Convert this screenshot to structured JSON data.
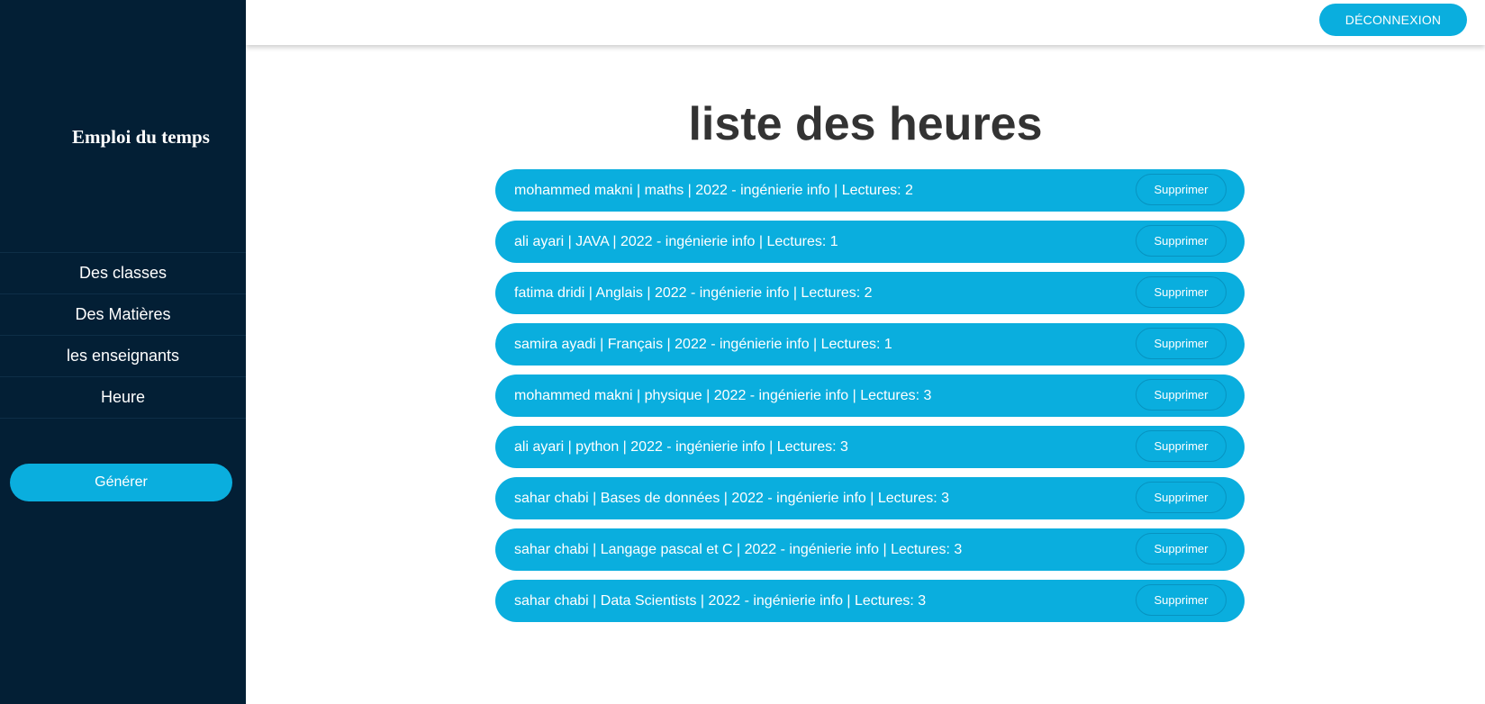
{
  "sidebar": {
    "brand": "Emploi du temps",
    "nav": [
      {
        "label": "Des classes"
      },
      {
        "label": "Des Matières"
      },
      {
        "label": "les enseignants"
      },
      {
        "label": "Heure"
      }
    ],
    "generate_label": "Générer"
  },
  "header": {
    "logout_label": "DÉCONNEXION"
  },
  "main": {
    "title": "liste des heures",
    "delete_label": "Supprimer",
    "items": [
      {
        "text": "mohammed makni | maths | 2022 - ingénierie info | Lectures: 2"
      },
      {
        "text": "ali ayari | JAVA | 2022 - ingénierie info | Lectures: 1"
      },
      {
        "text": "fatima dridi | Anglais | 2022 - ingénierie info | Lectures: 2"
      },
      {
        "text": "samira ayadi | Français | 2022 - ingénierie info | Lectures: 1"
      },
      {
        "text": "mohammed makni | physique | 2022 - ingénierie info | Lectures: 3"
      },
      {
        "text": "ali ayari | python | 2022 - ingénierie info | Lectures: 3"
      },
      {
        "text": "sahar chabi | Bases de données | 2022 - ingénierie info | Lectures: 3"
      },
      {
        "text": "sahar chabi | Langage pascal et C | 2022 - ingénierie info | Lectures: 3"
      },
      {
        "text": "sahar chabi | Data Scientists | 2022 - ingénierie info | Lectures: 3"
      }
    ]
  },
  "colors": {
    "sidebar_bg": "#031f35",
    "accent": "#0aaede",
    "title_text": "#333333"
  }
}
